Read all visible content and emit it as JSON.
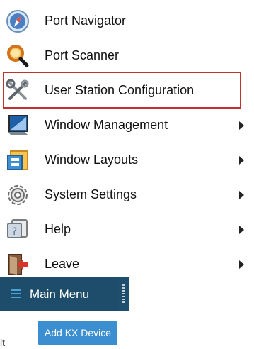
{
  "menu": {
    "items": [
      {
        "label": "Port Navigator",
        "icon": "compass-icon",
        "has_submenu": false
      },
      {
        "label": "Port Scanner",
        "icon": "magnifier-icon",
        "has_submenu": false
      },
      {
        "label": "User Station Configuration",
        "icon": "tools-icon",
        "has_submenu": false,
        "selected": true
      },
      {
        "label": "Window Management",
        "icon": "monitor-icon",
        "has_submenu": true
      },
      {
        "label": "Window Layouts",
        "icon": "layouts-icon",
        "has_submenu": true
      },
      {
        "label": "System Settings",
        "icon": "gear-icon",
        "has_submenu": true
      },
      {
        "label": "Help",
        "icon": "help-icon",
        "has_submenu": true
      },
      {
        "label": "Leave",
        "icon": "exit-icon",
        "has_submenu": true
      }
    ],
    "selected_border_color": "#c0332f"
  },
  "taskbar": {
    "main_menu_label": "Main Menu",
    "background": "#1e4c6b"
  },
  "actions": {
    "add_kx_device_label": "Add KX Device",
    "accent": "#3b8fd1"
  },
  "fragments": {
    "stray_text": "it"
  }
}
